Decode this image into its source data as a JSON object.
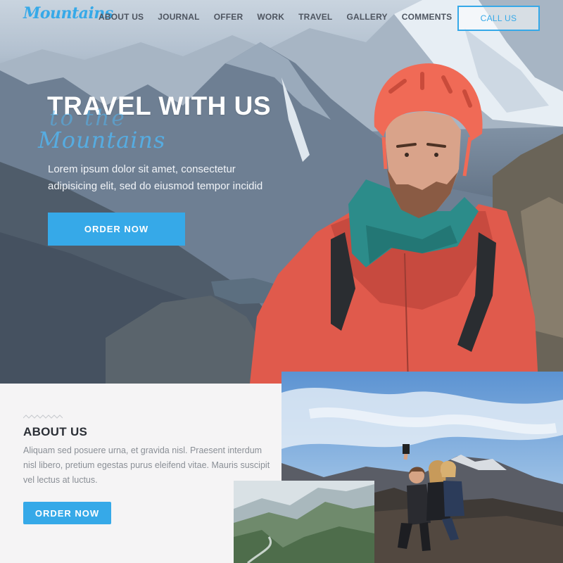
{
  "brand": {
    "logo": "Mountains"
  },
  "nav": {
    "items": [
      "ABOUT US",
      "JOURNAL",
      "OFFER",
      "WORK",
      "TRAVEL",
      "GALLERY",
      "COMMENTS"
    ],
    "cta": "CALL US"
  },
  "hero": {
    "title": "TRAVEL WITH US",
    "script_line1": "to the",
    "script_line2": "Mountains",
    "text": "Lorem ipsum dolor sit amet, consectetur adipisicing elit, sed do eiusmod tempor incidid",
    "button": "ORDER NOW"
  },
  "about": {
    "title": "ABOUT US",
    "text": "Aliquam sed posuere urna, et gravida nisl. Praesent interdum nisl libero, pretium egestas purus eleifend vitae. Mauris suscipit vel lectus at luctus.",
    "button": "ORDER NOW"
  },
  "colors": {
    "accent": "#36a9e8",
    "jacket": "#e2594b",
    "helmet": "#f06a56"
  }
}
